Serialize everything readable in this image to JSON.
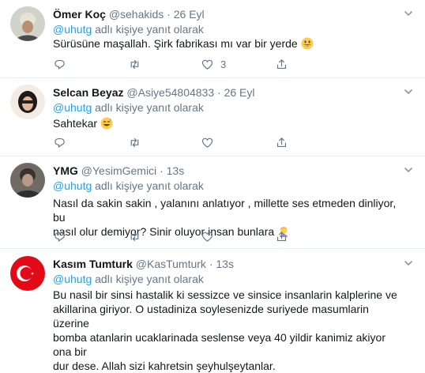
{
  "tweets": [
    {
      "name": "Ömer Koç",
      "handle": "@sehakids",
      "dot": "·",
      "time": "26 Eyl",
      "reply_mention": "@uhutg",
      "reply_text": "adlı kişiye yanıt olarak",
      "text": "Sürüsüne maşallah. Şirk fabrikası mı var bir yerde",
      "emoji": "grinning-face",
      "reply_count": "",
      "retweet_count": "",
      "like_count": "3"
    },
    {
      "name": "Selcan Beyaz",
      "handle": "@Asiye54804833",
      "dot": "·",
      "time": "26 Eyl",
      "reply_mention": "@uhutg",
      "reply_text": "adlı kişiye yanıt olarak",
      "text": "Sahtekar",
      "emoji": "grinning-sweat-face",
      "reply_count": "",
      "retweet_count": "",
      "like_count": ""
    },
    {
      "name": "YMG",
      "handle": "@YesimGemici",
      "dot": "·",
      "time": "13s",
      "reply_mention": "@uhutg",
      "reply_text": "adlı kişiye yanıt olarak",
      "text_line1": "Nasıl da sakin sakin , yalanını anlatıyor , millette ses etmeden dinliyor, bu",
      "text_line2": "nasıl olur demiyor? Sinir oluyor insan bunlara",
      "emoji": "woman-facepalming",
      "reply_count": "",
      "retweet_count": "",
      "like_count": ""
    },
    {
      "name": "Kasım Tumturk",
      "handle": "@KasTumturk",
      "dot": "·",
      "time": "13s",
      "reply_mention": "@uhutg",
      "reply_text": "adlı kişiye yanıt olarak",
      "text_lines": [
        "Bu nasil bir sinsi hastalik ki sessizce ve sinsice insanlarin kalplerine ve",
        "akillarina giriyor. O ustadiniza soylesenizde suriyede masumlarin üzerine",
        "bomba atanlarin ucaklarinada seslense veya 40 yildir kanimiz akiyor ona bir",
        "dur dese. Allah sizi kahretsin şeyhulşeytanlar."
      ]
    }
  ],
  "colors": {
    "text": "#14171a",
    "muted": "#657786",
    "link": "#1da1f2",
    "divider": "#e6ecf0"
  }
}
